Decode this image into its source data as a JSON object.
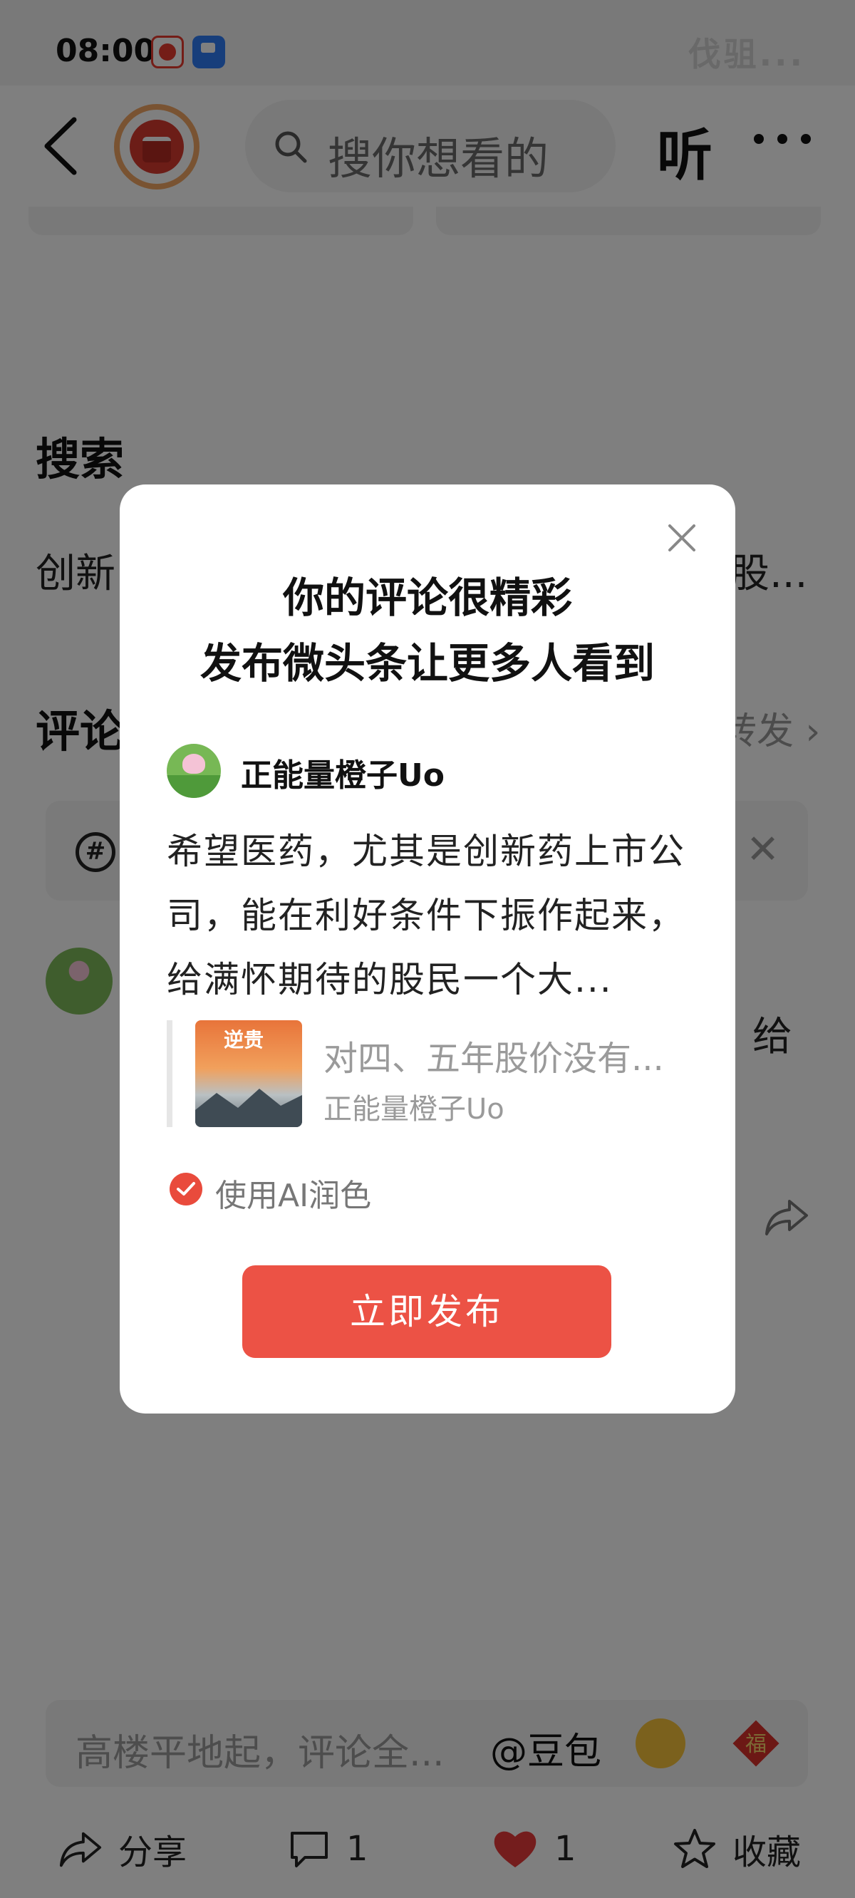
{
  "status_bar": {
    "time": "08:00",
    "watermark": "伐驵..."
  },
  "header": {
    "search_placeholder": "搜你想看的",
    "listen_label": "听"
  },
  "page": {
    "search_section_title": "搜索",
    "search_line_left": "创新",
    "search_line_right": "股...",
    "comments_section_title": "评论",
    "repost_label": "转发",
    "comment_fragment": "给"
  },
  "bottom": {
    "input_placeholder": "高楼平地起，评论全...",
    "at_label": "@豆包",
    "share_label": "分享",
    "comment_count": "1",
    "like_count": "1",
    "favorite_label": "收藏"
  },
  "modal": {
    "title_line1": "你的评论很精彩",
    "title_line2": "发布微头条让更多人看到",
    "username": "正能量橙子Uo",
    "comment_text": "希望医药，尤其是创新药上市公司，能在利好条件下振作起来，给满怀期待的股民一个大...",
    "quote_title": "对四、五年股价没有...",
    "quote_author": "正能量橙子Uo",
    "thumb_text": "逆贵",
    "ai_polish_label": "使用AI润色",
    "ai_polish_checked": true,
    "publish_button": "立即发布"
  },
  "colors": {
    "accent": "#ec5245",
    "like": "#e83b3b",
    "overlay": "rgba(0,0,0,0.5)"
  }
}
